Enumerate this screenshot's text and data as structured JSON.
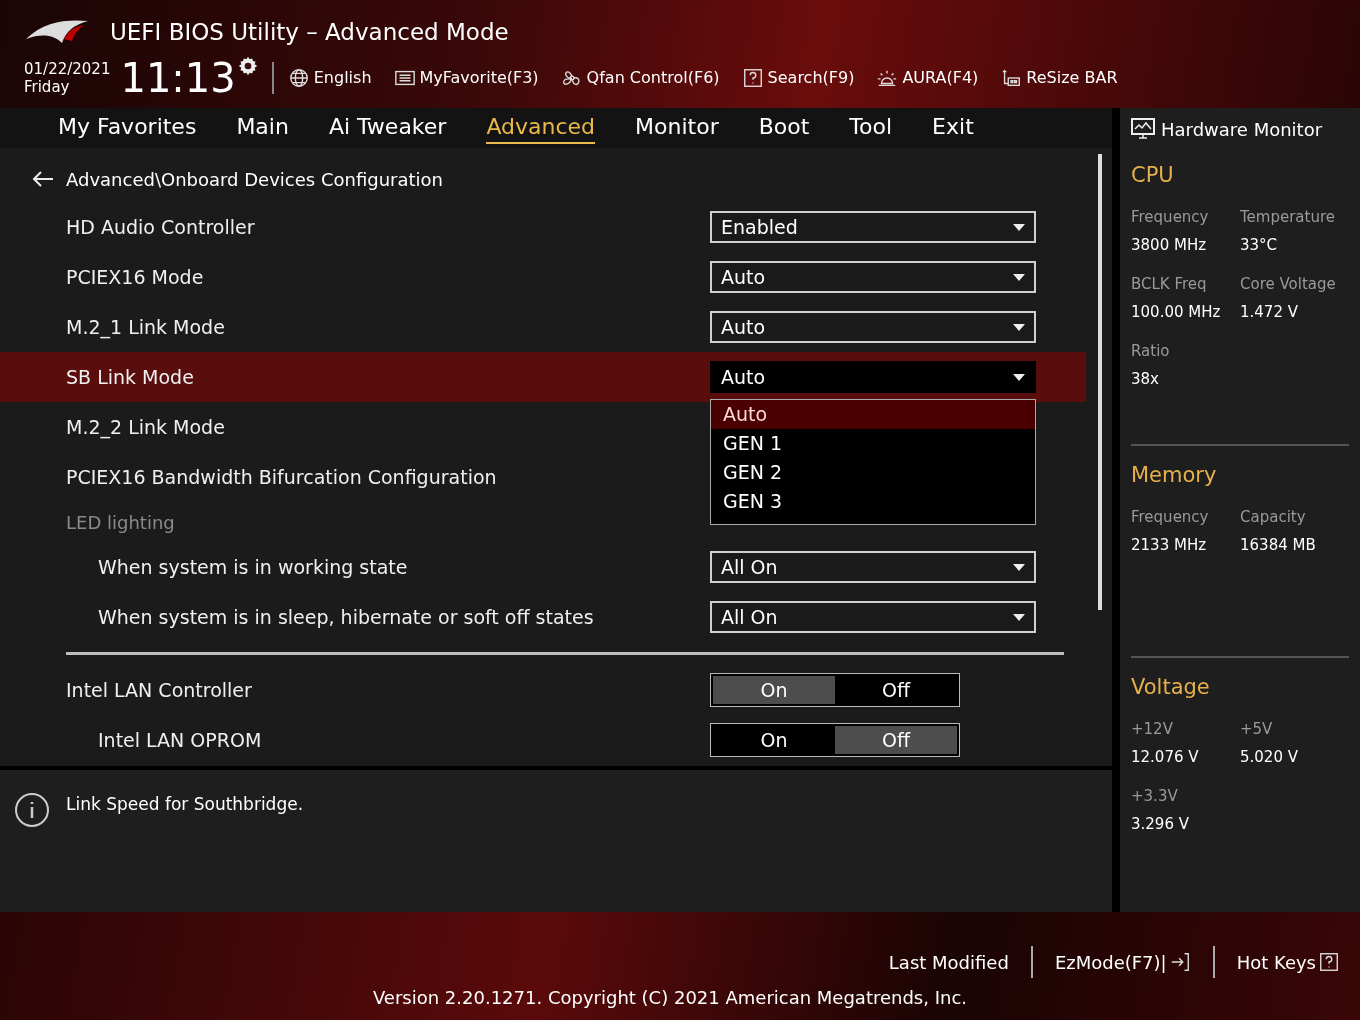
{
  "window": {
    "title": "UEFI BIOS Utility – Advanced Mode"
  },
  "clock": {
    "date": "01/22/2021",
    "day": "Friday",
    "time": "11:13"
  },
  "toolbar": [
    {
      "label": "English"
    },
    {
      "label": "MyFavorite(F3)"
    },
    {
      "label": "Qfan Control(F6)"
    },
    {
      "label": "Search(F9)"
    },
    {
      "label": "AURA(F4)"
    },
    {
      "label": "ReSize BAR"
    }
  ],
  "tabs": [
    {
      "label": "My Favorites",
      "selected": false
    },
    {
      "label": "Main",
      "selected": false
    },
    {
      "label": "Ai Tweaker",
      "selected": false
    },
    {
      "label": "Advanced",
      "selected": true
    },
    {
      "label": "Monitor",
      "selected": false
    },
    {
      "label": "Boot",
      "selected": false
    },
    {
      "label": "Tool",
      "selected": false
    },
    {
      "label": "Exit",
      "selected": false
    }
  ],
  "breadcrumb": "Advanced\\Onboard Devices Configuration",
  "settings": [
    {
      "kind": "dropdown",
      "label": "HD Audio Controller",
      "value": "Enabled",
      "selected": false
    },
    {
      "kind": "dropdown",
      "label": "PCIEX16 Mode",
      "value": "Auto",
      "selected": false
    },
    {
      "kind": "dropdown",
      "label": "M.2_1 Link Mode",
      "value": "Auto",
      "selected": false
    },
    {
      "kind": "dropdown",
      "label": "SB Link Mode",
      "value": "Auto",
      "selected": true,
      "options": [
        {
          "label": "Auto",
          "selected": true
        },
        {
          "label": "GEN 1",
          "selected": false
        },
        {
          "label": "GEN 2",
          "selected": false
        },
        {
          "label": "GEN 3",
          "selected": false
        }
      ]
    },
    {
      "kind": "link",
      "label": "M.2_2 Link Mode",
      "selected": false
    },
    {
      "kind": "link",
      "label": "PCIEX16 Bandwidth Bifurcation Configuration",
      "selected": false
    },
    {
      "kind": "section",
      "label": "LED lighting",
      "children": [
        {
          "kind": "dropdown",
          "label": "When system is in working state",
          "value": "All On",
          "selected": false
        },
        {
          "kind": "dropdown",
          "label": "When system is in sleep, hibernate or soft off states",
          "value": "All On",
          "selected": false
        }
      ]
    },
    {
      "kind": "divider"
    },
    {
      "kind": "toggle",
      "label": "Intel LAN Controller",
      "selected": false,
      "options": [
        {
          "label": "On",
          "selected": true
        },
        {
          "label": "Off",
          "selected": false
        }
      ],
      "children": [
        {
          "kind": "toggle",
          "label": "Intel LAN OPROM",
          "selected": false,
          "options": [
            {
              "label": "On",
              "selected": false
            },
            {
              "label": "Off",
              "selected": true
            }
          ]
        }
      ]
    }
  ],
  "help": "Link Speed for Southbridge.",
  "hardware_monitor": {
    "title": "Hardware Monitor",
    "groups": [
      {
        "title": "CPU",
        "items": [
          {
            "label": "Frequency",
            "value": "3800 MHz"
          },
          {
            "label": "Temperature",
            "value": "33°C"
          },
          {
            "label": "BCLK Freq",
            "value": "100.00 MHz"
          },
          {
            "label": "Core Voltage",
            "value": "1.472 V"
          },
          {
            "label": "Ratio",
            "value": "38x"
          }
        ]
      },
      {
        "title": "Memory",
        "items": [
          {
            "label": "Frequency",
            "value": "2133 MHz"
          },
          {
            "label": "Capacity",
            "value": "16384 MB"
          }
        ]
      },
      {
        "title": "Voltage",
        "items": [
          {
            "label": "+12V",
            "value": "12.076 V"
          },
          {
            "label": "+5V",
            "value": "5.020 V"
          },
          {
            "label": "+3.3V",
            "value": "3.296 V"
          }
        ]
      }
    ]
  },
  "footer": {
    "buttons": [
      {
        "label": "Last Modified"
      },
      {
        "label": "EzMode(F7)|"
      },
      {
        "label": "Hot Keys"
      }
    ],
    "version": "Version 2.20.1271. Copyright (C) 2021 American Megatrends, Inc."
  }
}
